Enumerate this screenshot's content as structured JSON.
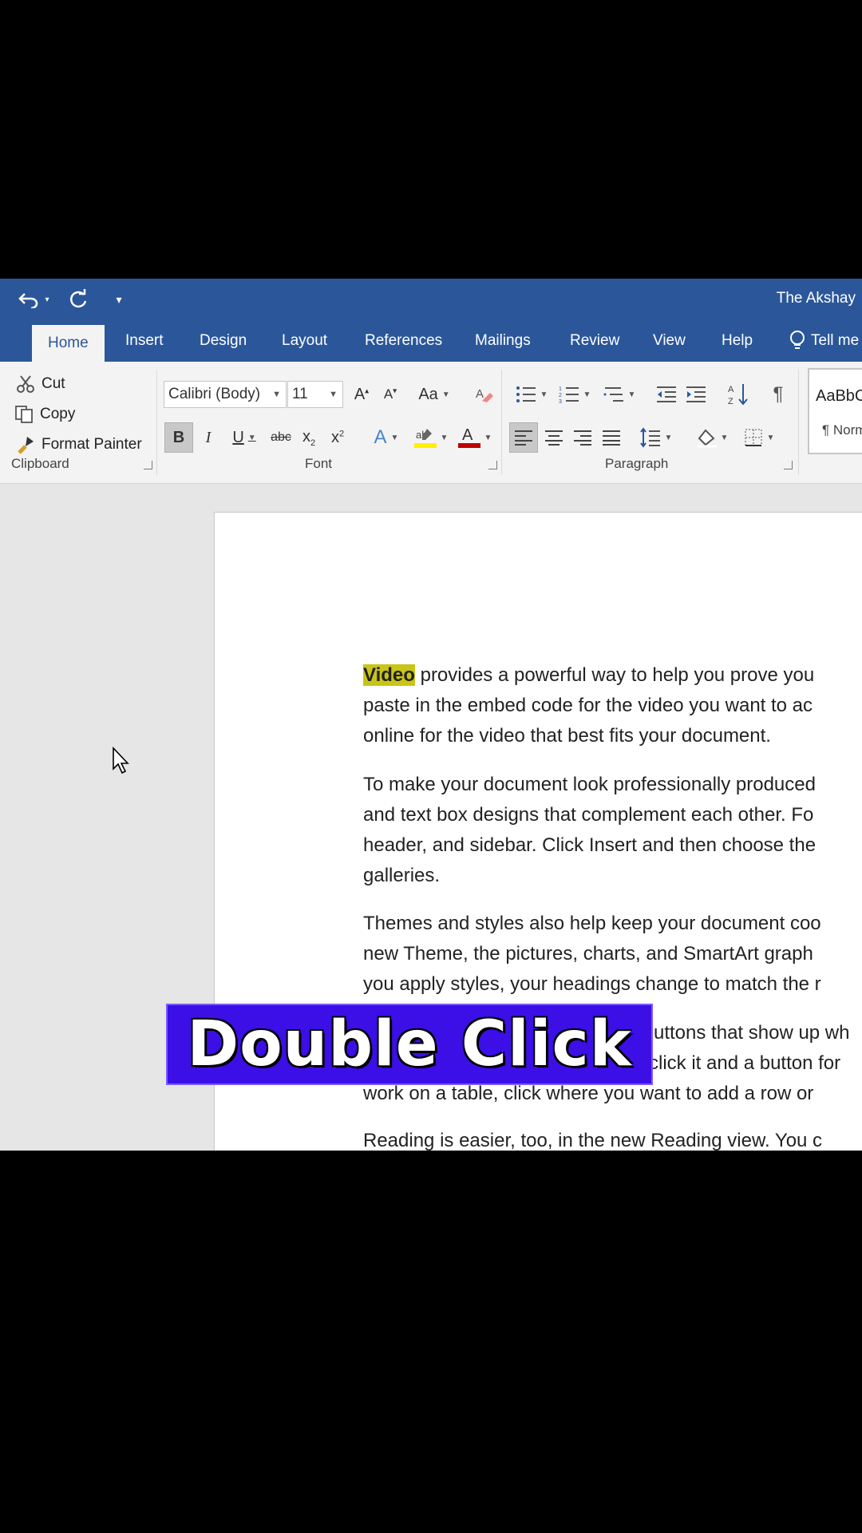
{
  "titlebar": {
    "owner": "The Akshay"
  },
  "tabs": [
    "Home",
    "Insert",
    "Design",
    "Layout",
    "References",
    "Mailings",
    "Review",
    "View",
    "Help",
    "Tell me"
  ],
  "clipboard": {
    "cut": "Cut",
    "copy": "Copy",
    "painter": "Format Painter",
    "label": "Clipboard"
  },
  "font": {
    "name": "Calibri (Body)",
    "size": "11",
    "label": "Font",
    "case": "Aa"
  },
  "paragraph": {
    "label": "Paragraph"
  },
  "styles": {
    "sample": "AaBbC",
    "normal": "¶ Norm"
  },
  "document": {
    "p1": {
      "highlight": "Video",
      "line1": " provides a powerful way to help you prove you",
      "line2": "paste in the embed code for the video you want to ac",
      "line3": "online for the video that best fits your document."
    },
    "p2": {
      "line1": "To make your document look professionally produced",
      "line2": "and text box designs that complement each other. Fo",
      "line3": "header, and sidebar. Click Insert and then choose the",
      "line4": "galleries."
    },
    "p3": {
      "line1": "Themes and styles also help keep your document coo",
      "line2": "new Theme, the pictures, charts, and SmartArt graph",
      "line3": "you apply styles, your headings change to match the r"
    },
    "p4": {
      "line1": "uttons that show up wh",
      "line2": "click it and a button for",
      "line3": "work on a table, click where you want to add a row or"
    },
    "p5": {
      "line1": "Reading is easier, too, in the new Reading view. You c"
    }
  },
  "caption": "Double Click",
  "colors": {
    "titlebar": "#2b579a",
    "highlight": "#c9c419",
    "caption_bg": "#3b0fe6"
  }
}
